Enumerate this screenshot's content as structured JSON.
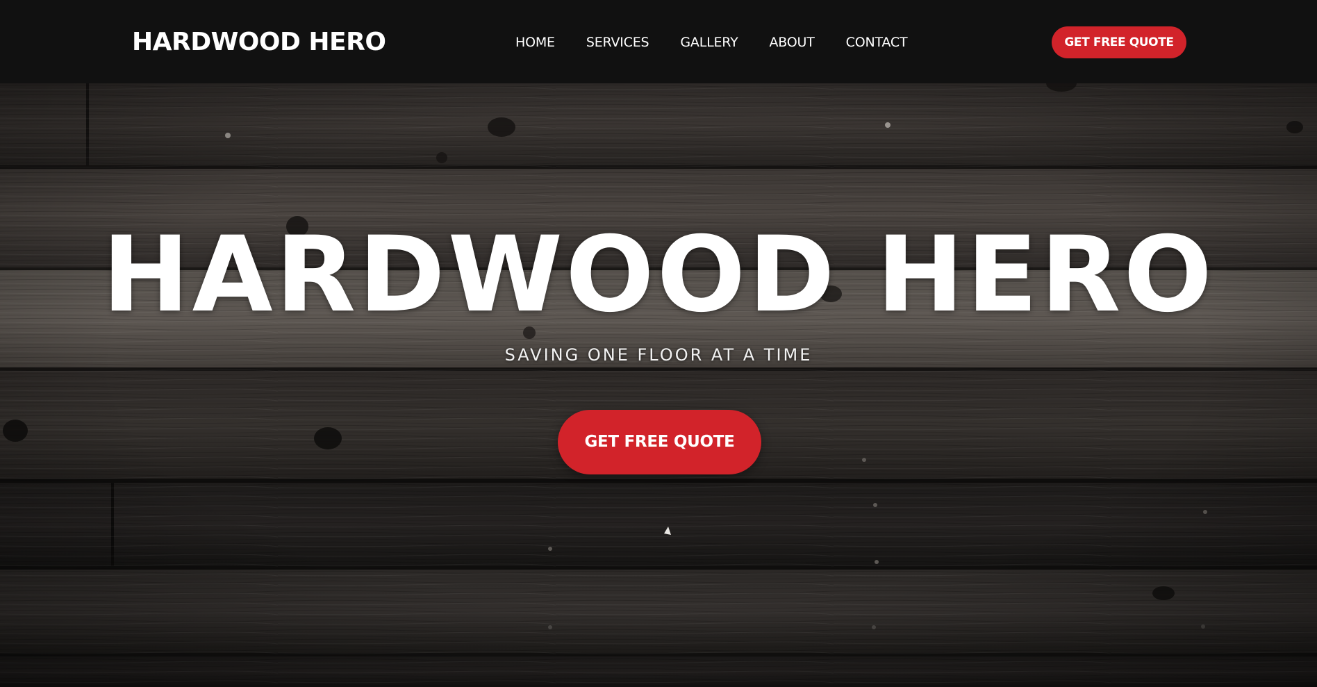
{
  "header": {
    "logo": "HARDWOOD HERO",
    "nav": [
      {
        "label": "HOME"
      },
      {
        "label": "SERVICES"
      },
      {
        "label": "GALLERY"
      },
      {
        "label": "ABOUT"
      },
      {
        "label": "CONTACT"
      }
    ],
    "cta_label": "GET FREE QUOTE"
  },
  "hero": {
    "title": "HARDWOOD HERO",
    "subtitle": "SAVING ONE FLOOR AT A TIME",
    "cta_label": "GET FREE QUOTE",
    "background": "dark-wood-planks"
  },
  "colors": {
    "header_bg": "#111111",
    "accent": "#d2232a",
    "text": "#ffffff",
    "wood_dark": "#1c1a19",
    "wood_mid": "#3b3633"
  }
}
